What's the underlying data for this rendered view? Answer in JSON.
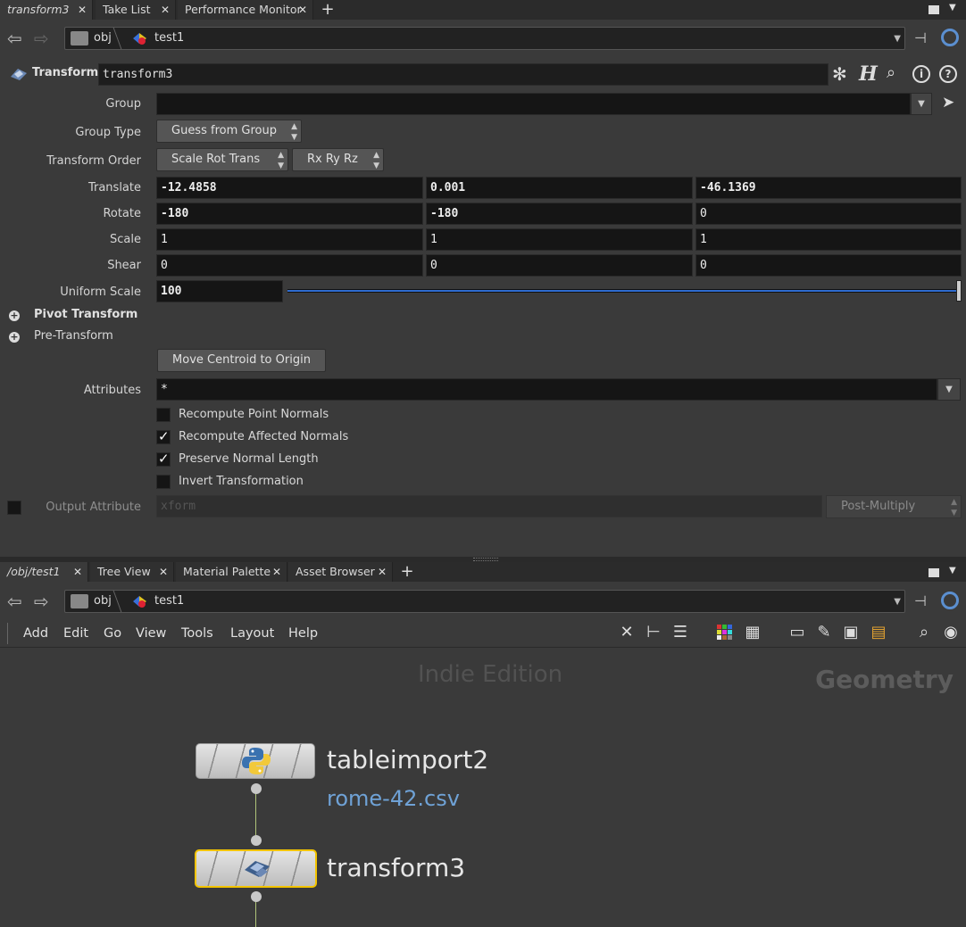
{
  "top_tabs": [
    {
      "label": "transform3",
      "active": true
    },
    {
      "label": "Take List",
      "active": false
    },
    {
      "label": "Performance Monitor",
      "active": false
    }
  ],
  "top_path": {
    "root": "obj",
    "node": "test1"
  },
  "param_header": {
    "type": "Transform",
    "name": "transform3"
  },
  "params": {
    "group_label": "Group",
    "group_value": "",
    "group_type_label": "Group Type",
    "group_type_value": "Guess from Group",
    "transform_order_label": "Transform Order",
    "transform_order_value": "Scale Rot Trans",
    "rotation_order_value": "Rx Ry Rz",
    "translate_label": "Translate",
    "translate": [
      "-12.4858",
      "0.001",
      "-46.1369"
    ],
    "rotate_label": "Rotate",
    "rotate": [
      "-180",
      "-180",
      "0"
    ],
    "scale_label": "Scale",
    "scale": [
      "1",
      "1",
      "1"
    ],
    "shear_label": "Shear",
    "shear": [
      "0",
      "0",
      "0"
    ],
    "uniform_scale_label": "Uniform Scale",
    "uniform_scale": "100",
    "pivot_transform_label": "Pivot Transform",
    "pre_transform_label": "Pre-Transform",
    "move_centroid_label": "Move Centroid to Origin",
    "attributes_label": "Attributes",
    "attributes_value": "*",
    "recompute_point_normals": "Recompute Point Normals",
    "recompute_affected_normals": "Recompute Affected Normals",
    "preserve_normal_length": "Preserve Normal Length",
    "invert_transformation": "Invert Transformation",
    "output_attribute_label": "Output Attribute",
    "output_attribute_placeholder": "xform",
    "output_mode": "Post-Multiply",
    "checks": {
      "recompute_point_normals": false,
      "recompute_affected_normals": true,
      "preserve_normal_length": true,
      "invert_transformation": false,
      "output_attribute": false
    }
  },
  "bottom_tabs": [
    {
      "label": "/obj/test1",
      "active": true
    },
    {
      "label": "Tree View",
      "active": false
    },
    {
      "label": "Material Palette",
      "active": false
    },
    {
      "label": "Asset Browser",
      "active": false
    }
  ],
  "bottom_path": {
    "root": "obj",
    "node": "test1"
  },
  "net_menu": [
    "Add",
    "Edit",
    "Go",
    "View",
    "Tools",
    "Layout",
    "Help"
  ],
  "network": {
    "watermark": "Indie Edition",
    "context": "Geometry",
    "nodes": [
      {
        "name": "tableimport2",
        "comment": "rome-42.csv",
        "icon": "python-icon"
      },
      {
        "name": "transform3",
        "icon": "transform-icon",
        "selected": true
      }
    ]
  },
  "colors": {
    "selection": "#f3c400",
    "link": "#6fa2d6",
    "slider": "#2f6ccf"
  }
}
